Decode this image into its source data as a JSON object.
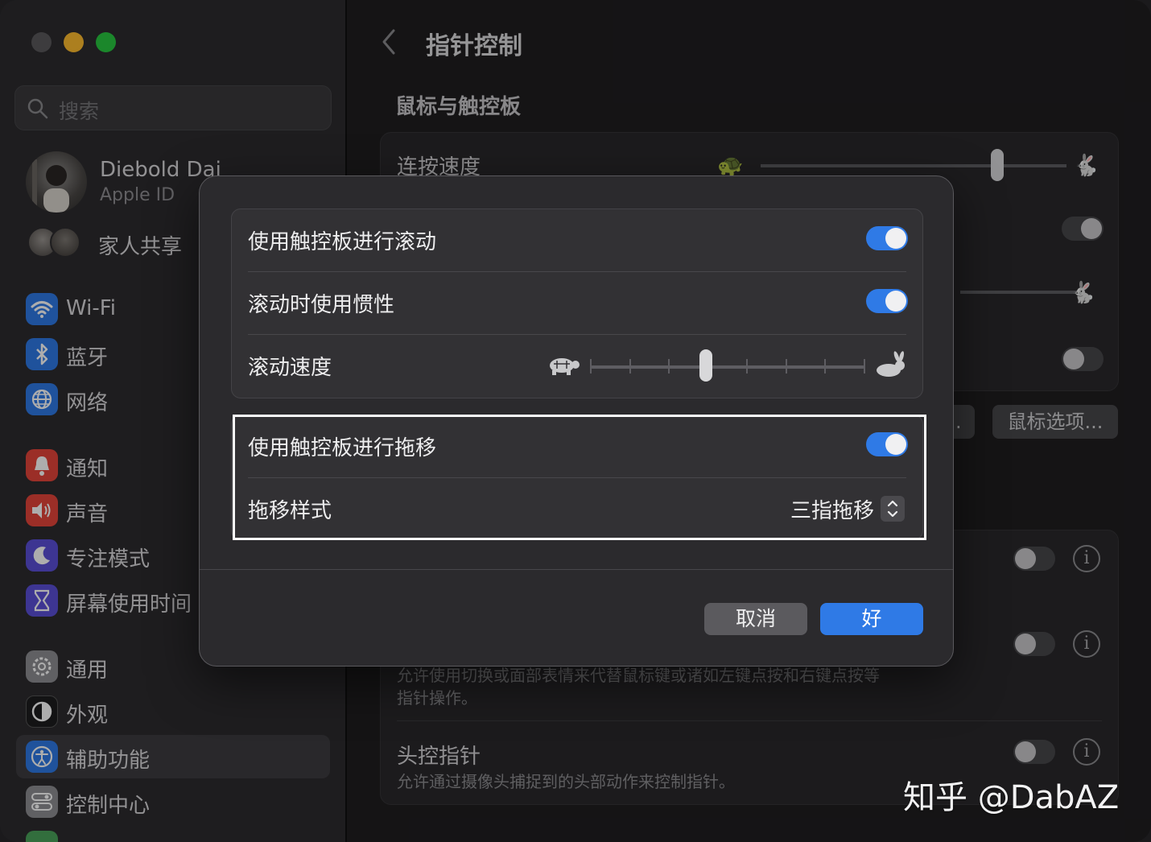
{
  "sidebar": {
    "search_placeholder": "搜索",
    "profile": {
      "name": "Diebold Dai",
      "subtitle": "Apple ID"
    },
    "family_label": "家人共享",
    "items": [
      {
        "label": "Wi-Fi",
        "icon": "wifi-icon",
        "color": "#2f7ae6"
      },
      {
        "label": "蓝牙",
        "icon": "bluetooth-icon",
        "color": "#2f7ae6"
      },
      {
        "label": "网络",
        "icon": "globe-icon",
        "color": "#2f7ae6"
      },
      {
        "label": "通知",
        "icon": "bell-icon",
        "color": "#e5453a"
      },
      {
        "label": "声音",
        "icon": "speaker-icon",
        "color": "#e5453a"
      },
      {
        "label": "专注模式",
        "icon": "moon-icon",
        "color": "#5a4fd8"
      },
      {
        "label": "屏幕使用时间",
        "icon": "hourglass-icon",
        "color": "#5a4fd8"
      },
      {
        "label": "通用",
        "icon": "gear-icon",
        "color": "#8e8e93"
      },
      {
        "label": "外观",
        "icon": "appearance-icon",
        "color": "#1c1c1e"
      },
      {
        "label": "辅助功能",
        "icon": "accessibility-icon",
        "color": "#2f7ae6",
        "active": true
      },
      {
        "label": "控制中心",
        "icon": "control-center-icon",
        "color": "#8e8e93"
      }
    ]
  },
  "main": {
    "title": "指针控制",
    "section": "鼠标与触控板",
    "double_click_speed_label": "连按速度",
    "mouse_options_button": "鼠标选项...",
    "partial_button": ".",
    "alt_pointer_desc_line1": "允许使用切换或面部表情来代替鼠标键或诸如左键点按和右键点按等",
    "alt_pointer_desc_line2": "指针操作。",
    "head_pointer_label": "头控指针",
    "head_pointer_desc": "允许通过摄像头捕捉到的头部动作来控制指针。",
    "info_glyph": "i"
  },
  "dialog": {
    "scroll_toggle_label": "使用触控板进行滚动",
    "scroll_toggle_on": true,
    "inertia_label": "滚动时使用惯性",
    "inertia_on": true,
    "scroll_speed_label": "滚动速度",
    "scroll_speed_fraction": 0.42,
    "drag_toggle_label": "使用触控板进行拖移",
    "drag_toggle_on": true,
    "drag_style_label": "拖移样式",
    "drag_style_value": "三指拖移",
    "cancel_label": "取消",
    "ok_label": "好"
  },
  "watermark": "知乎 @DabAZ",
  "colors": {
    "accent": "#2f7ae6",
    "close": "#5a595c",
    "minimize": "#febc2e",
    "zoom": "#28c840"
  }
}
